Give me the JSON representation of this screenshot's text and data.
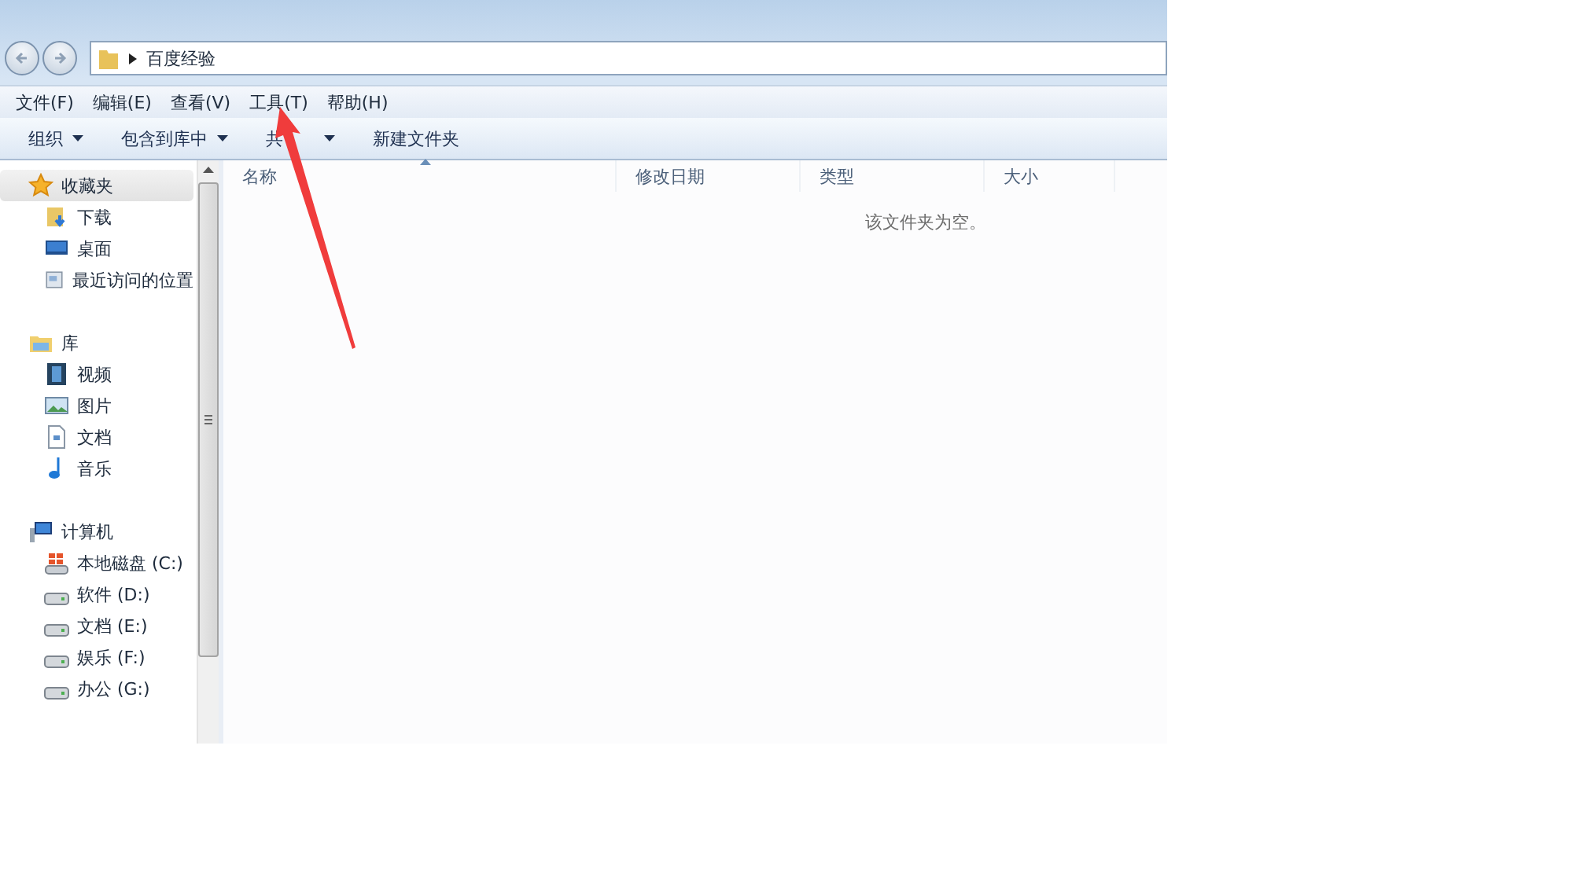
{
  "address_bar": {
    "path": [
      "百度经验"
    ]
  },
  "menu_bar": [
    "文件(F)",
    "编辑(E)",
    "查看(V)",
    "工具(T)",
    "帮助(H)"
  ],
  "toolbar": [
    {
      "label": "组织",
      "dropdown": true
    },
    {
      "label": "包含到库中",
      "dropdown": true
    },
    {
      "label": "共",
      "dropdown": true
    },
    {
      "label": "新建文件夹",
      "dropdown": false
    }
  ],
  "sidebar": [
    {
      "label": "收藏夹",
      "kind": "favorites",
      "selected": true,
      "children": [
        {
          "label": "下载",
          "kind": "download",
          "selected": false
        },
        {
          "label": "桌面",
          "kind": "desktop",
          "selected": false
        },
        {
          "label": "最近访问的位置",
          "kind": "recent",
          "selected": false
        }
      ]
    },
    {
      "label": "库",
      "kind": "library",
      "selected": false,
      "children": [
        {
          "label": "视频",
          "kind": "video",
          "selected": false
        },
        {
          "label": "图片",
          "kind": "image",
          "selected": false
        },
        {
          "label": "文档",
          "kind": "document",
          "selected": false
        },
        {
          "label": "音乐",
          "kind": "music",
          "selected": false
        }
      ]
    },
    {
      "label": "计算机",
      "kind": "computer",
      "selected": false,
      "children": [
        {
          "label": "本地磁盘 (C:)",
          "kind": "system-drive",
          "selected": false
        },
        {
          "label": "软件 (D:)",
          "kind": "drive",
          "selected": false
        },
        {
          "label": "文档 (E:)",
          "kind": "drive",
          "selected": false
        },
        {
          "label": "娱乐 (F:)",
          "kind": "drive",
          "selected": false
        },
        {
          "label": "办公 (G:)",
          "kind": "drive",
          "selected": false
        }
      ]
    }
  ],
  "file_list": {
    "columns": [
      {
        "label": "名称",
        "sorted": true
      },
      {
        "label": "修改日期",
        "sorted": false
      },
      {
        "label": "类型",
        "sorted": false
      },
      {
        "label": "大小",
        "sorted": false
      }
    ],
    "empty_message": "该文件夹为空。"
  },
  "annotation": {
    "kind": "arrow"
  }
}
